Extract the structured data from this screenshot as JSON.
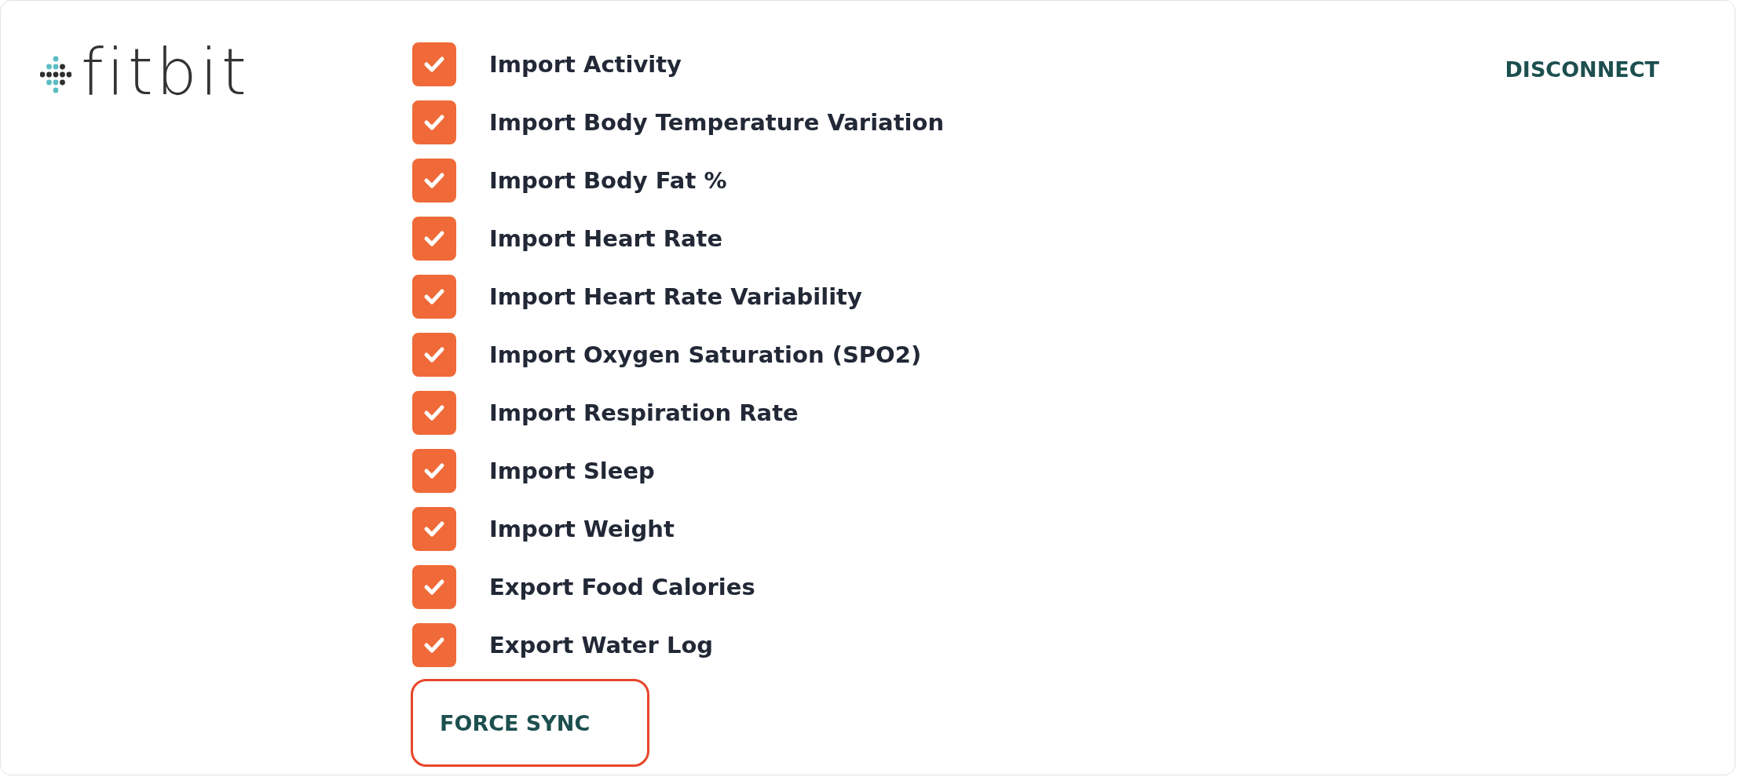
{
  "logo": {
    "text": "fitbit"
  },
  "options": [
    {
      "label": "Import Activity",
      "checked": true
    },
    {
      "label": "Import Body Temperature Variation",
      "checked": true
    },
    {
      "label": "Import Body Fat %",
      "checked": true
    },
    {
      "label": "Import Heart Rate",
      "checked": true
    },
    {
      "label": "Import Heart Rate Variability",
      "checked": true
    },
    {
      "label": "Import Oxygen Saturation (SPO2)",
      "checked": true
    },
    {
      "label": "Import Respiration Rate",
      "checked": true
    },
    {
      "label": "Import Sleep",
      "checked": true
    },
    {
      "label": "Import Weight",
      "checked": true
    },
    {
      "label": "Export Food Calories",
      "checked": true
    },
    {
      "label": "Export Water Log",
      "checked": true
    }
  ],
  "force_sync_button": "FORCE SYNC",
  "disconnect_link": "DISCONNECT"
}
